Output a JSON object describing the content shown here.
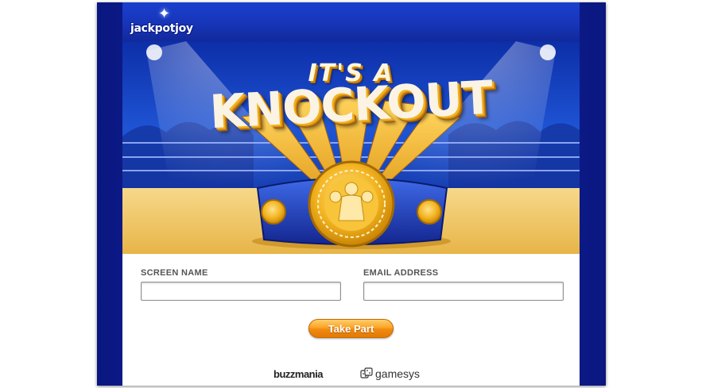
{
  "brand": {
    "logo_text": "jackpotjoy"
  },
  "hero": {
    "headline_top": "IT'S A",
    "headline_main": "KNOCKOUT"
  },
  "form": {
    "screen_name_label": "SCREEN NAME",
    "screen_name_value": "",
    "email_label": "EMAIL ADDRESS",
    "email_value": "",
    "submit_label": "Take Part"
  },
  "footer": {
    "partner_1": "buzzmania",
    "partner_2": "gamesys"
  },
  "colors": {
    "frame_blue": "#1a2fb8",
    "header_blue": "#1634b6",
    "gold": "#f2b31b",
    "button_orange": "#f08a10"
  },
  "icons": [
    "sparkle-star-icon",
    "championship-belt-icon",
    "dice-icon"
  ]
}
